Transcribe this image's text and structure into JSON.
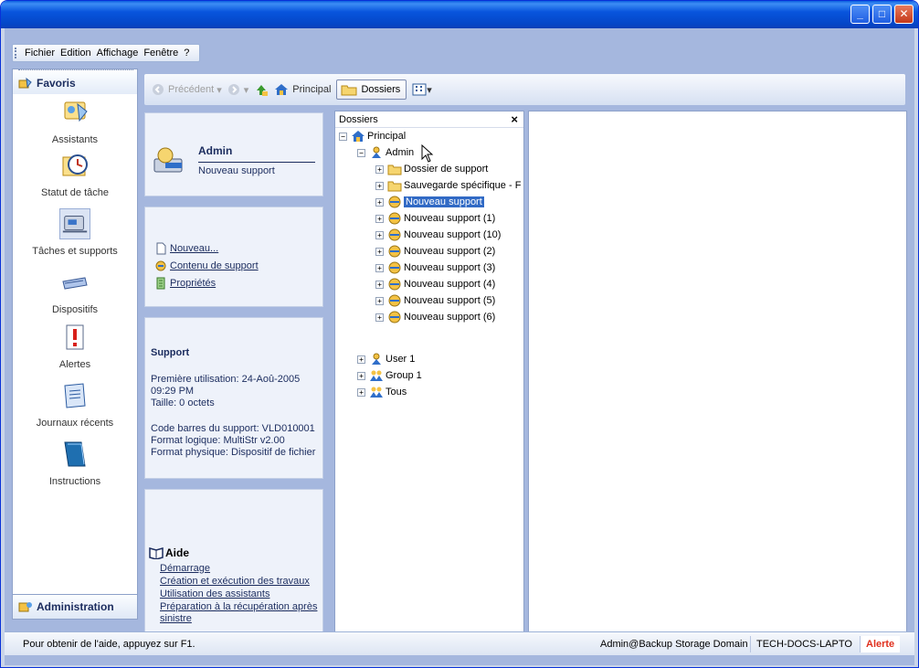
{
  "menu": [
    "Fichier",
    "Edition",
    "Affichage",
    "Fenêtre",
    "?"
  ],
  "favorites": {
    "title": "Favoris",
    "items": [
      "Assistants",
      "Statut de tâche",
      "Tâches et supports",
      "Dispositifs",
      "Alertes",
      "Journaux récents",
      "Instructions"
    ]
  },
  "admin_tab": "Administration",
  "toolbar": {
    "back": "Précédent",
    "principal": "Principal",
    "dossiers": "Dossiers"
  },
  "tasks": {
    "header": {
      "name": "Admin",
      "sub": "Nouveau support"
    },
    "links": [
      "Nouveau...",
      "Contenu de support",
      "Propriétés"
    ],
    "support": {
      "title": "Support",
      "first_use": "Première utilisation: 24-Aoû-2005 09:29 PM",
      "size": "Taille: 0 octets",
      "barcode": "Code barres du support: VLD010001",
      "logical": "Format logique: MultiStr v2.00",
      "physical": "Format physique: Dispositif de fichier"
    },
    "help": {
      "title": "Aide",
      "links": [
        "Démarrage",
        "Création et exécution des travaux",
        "Utilisation des assistants",
        "Préparation à la récupération après sinistre"
      ]
    }
  },
  "tree": {
    "title": "Dossiers",
    "close": "×",
    "root": "Principal",
    "admin": "Admin",
    "children": [
      "Dossier de support",
      "Sauvegarde spécifique - F",
      "Nouveau support",
      "Nouveau support (1)",
      "Nouveau support (10)",
      "Nouveau support (2)",
      "Nouveau support (3)",
      "Nouveau support (4)",
      "Nouveau support (5)",
      "Nouveau support (6)"
    ],
    "selected_child": "Nouveau support",
    "others": [
      "User 1",
      "Group 1",
      "Tous"
    ]
  },
  "status": {
    "help": "Pour obtenir de l'aide, appuyez sur F1.",
    "user": "Admin@Backup Storage Domain",
    "machine": "TECH-DOCS-LAPTO",
    "alert": "Alerte"
  },
  "colors": {
    "selection": "#316ac5",
    "alert": "#e0301e",
    "link": "#1b2c5e"
  }
}
